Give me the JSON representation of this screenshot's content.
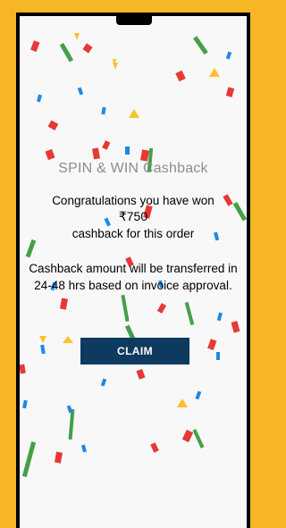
{
  "dialog": {
    "title": "SPIN & WIN Cashback",
    "line_congrats": "Congratulations you have won",
    "amount": "₹750",
    "line_cashback": "cashback for this order",
    "line_transfer_1": "Cashback amount will be transferred in",
    "line_transfer_2": "24-48 hrs based on invoice approval.",
    "claim_label": "CLAIM"
  },
  "colors": {
    "frame": "#f6b625",
    "claim_button": "#0f3a60",
    "confetti": [
      "#e53935",
      "#43a047",
      "#1e88e5",
      "#fbc02d"
    ]
  }
}
